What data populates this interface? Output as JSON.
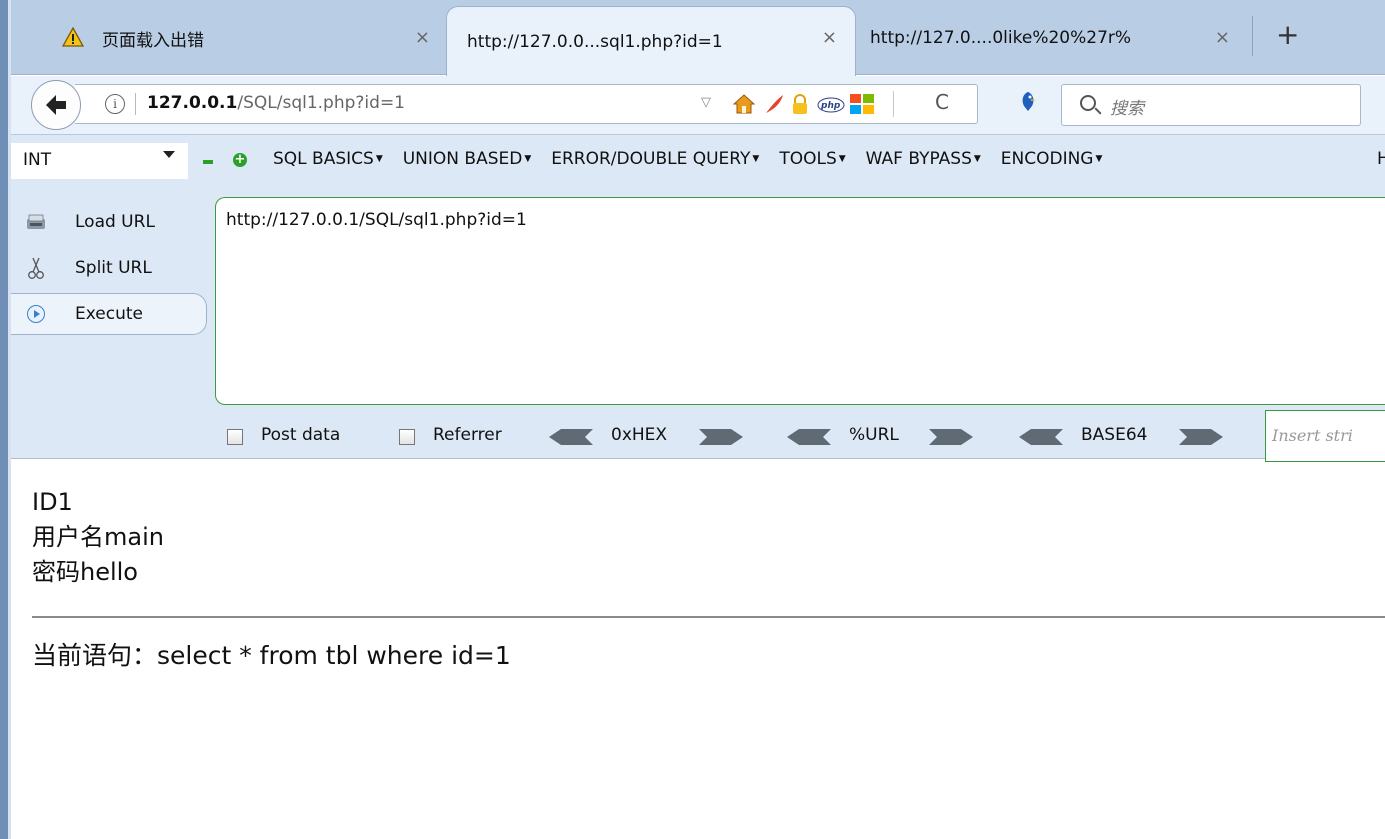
{
  "tabs": [
    {
      "title": "页面载入出错",
      "close": "×"
    },
    {
      "title": "http://127.0.0...sql1.php?id=1",
      "close": "×"
    },
    {
      "title": "http://127.0....0like%20%27r%",
      "close": "×"
    }
  ],
  "new_tab": "+",
  "nav": {
    "url_host": "127.0.0.1",
    "url_path": "/SQL/sql1.php?id=1",
    "search_placeholder": "搜索",
    "dropmark": "▽",
    "refresh": "C"
  },
  "hackbar": {
    "type_select": "INT",
    "menus": [
      "SQL BASICS",
      "UNION BASED",
      "ERROR/DOUBLE QUERY",
      "TOOLS",
      "WAF BYPASS",
      "ENCODING"
    ],
    "menu_tail": "H",
    "buttons": {
      "load": "Load URL",
      "split": "Split URL",
      "execute": "Execute"
    },
    "url_value": "http://127.0.0.1/SQL/sql1.php?id=1",
    "options": {
      "post_data": "Post data",
      "referrer": "Referrer",
      "hex": "0xHEX",
      "url": "%URL",
      "base64": "BASE64"
    },
    "insert_placeholder": "Insert stri"
  },
  "result": {
    "id_line": "ID1",
    "user_line": "用户名main",
    "pass_line": "密码hello",
    "statement": "当前语句：select * from tbl where id=1"
  }
}
